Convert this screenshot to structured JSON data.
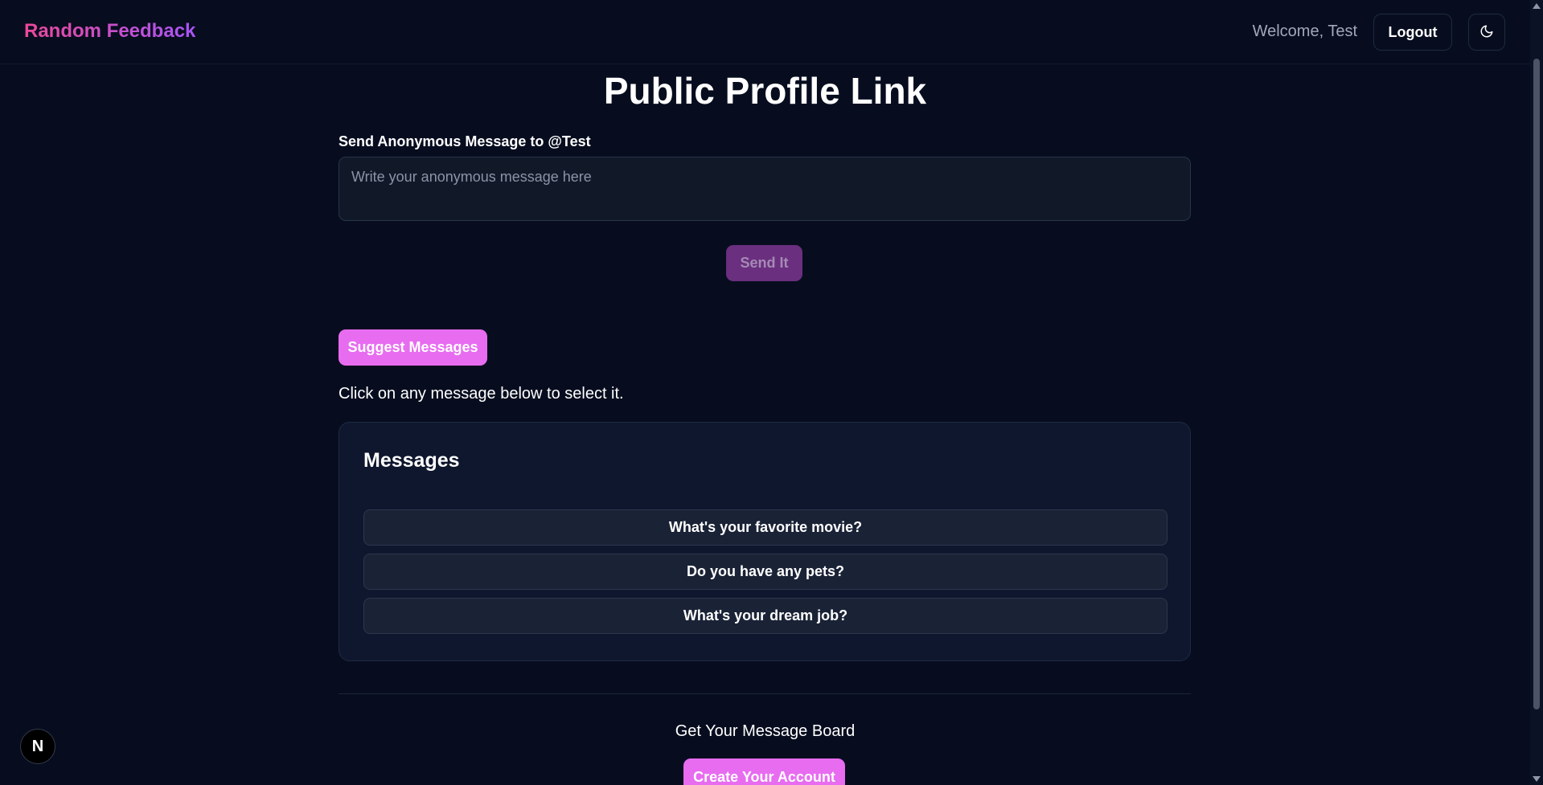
{
  "header": {
    "brand": "Random Feedback",
    "welcome": "Welcome, Test",
    "logout_label": "Logout",
    "theme_icon": "moon-icon"
  },
  "main": {
    "title": "Public Profile Link",
    "field_label": "Send Anonymous Message to @Test",
    "input_placeholder": "Write your anonymous message here",
    "input_value": "",
    "send_label": "Send It",
    "suggest_label": "Suggest Messages",
    "hint": "Click on any message below to select it.",
    "messages_card": {
      "title": "Messages",
      "items": [
        "What's your favorite movie?",
        "Do you have any pets?",
        "What's your dream job?"
      ]
    }
  },
  "footer": {
    "cta_text": "Get Your Message Board",
    "create_label": "Create Your Account"
  },
  "badge": {
    "label": "N"
  },
  "colors": {
    "background": "#070d1f",
    "accent": "#e76cf0",
    "accent_disabled": "#6b2f7f",
    "brand_gradient_start": "#ec4899",
    "brand_gradient_end": "#a855f7"
  }
}
